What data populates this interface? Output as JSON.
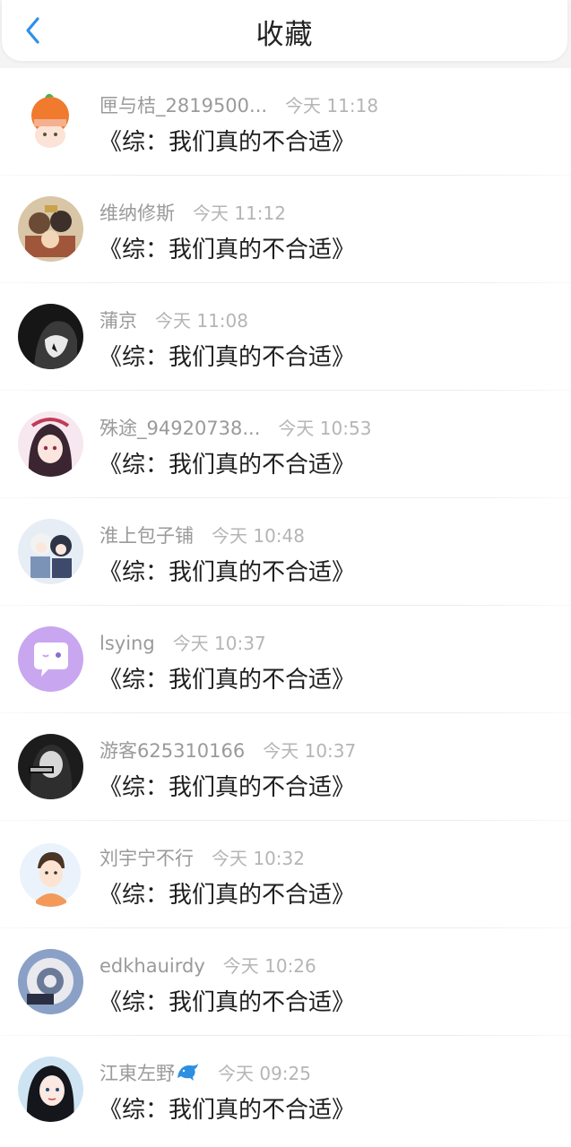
{
  "header": {
    "title": "收藏",
    "back_icon": "chevron-left-icon",
    "accent_color": "#2f8fe8"
  },
  "items": [
    {
      "user": "匣与桔_2819500...",
      "time": "今天 11:18",
      "book": "《综：我们真的不合适》"
    },
    {
      "user": "维纳修斯",
      "time": "今天 11:12",
      "book": "《综：我们真的不合适》"
    },
    {
      "user": "蒲京",
      "time": "今天 11:08",
      "book": "《综：我们真的不合适》"
    },
    {
      "user": "殊途_94920738...",
      "time": "今天 10:53",
      "book": "《综：我们真的不合适》"
    },
    {
      "user": "淮上包子铺",
      "time": "今天 10:48",
      "book": "《综：我们真的不合适》"
    },
    {
      "user": "lsying",
      "time": "今天 10:37",
      "book": "《综：我们真的不合适》"
    },
    {
      "user": "游客625310166",
      "time": "今天 10:37",
      "book": "《综：我们真的不合适》"
    },
    {
      "user": "刘宇宁不行",
      "time": "今天 10:32",
      "book": "《综：我们真的不合适》"
    },
    {
      "user": "edkhauirdy",
      "time": "今天 10:26",
      "book": "《综：我们真的不合适》"
    },
    {
      "user": "江東左野",
      "time": "今天 09:25",
      "book": "《综：我们真的不合适》"
    }
  ]
}
